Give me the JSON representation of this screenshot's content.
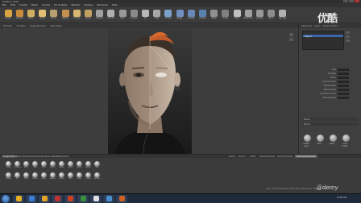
{
  "window": {
    "title": "Mudbox 2014"
  },
  "menu": [
    "File",
    "Edit",
    "Create",
    "Mesh",
    "Curves",
    "UV & Maps",
    "Render",
    "Display",
    "Windows",
    "Help"
  ],
  "toolbar_tools": [
    {
      "label": "Sculpt",
      "color": "#d9a441"
    },
    {
      "label": "Smooth",
      "color": "#c98a3a"
    },
    {
      "label": "Relax",
      "color": "#d0b060"
    },
    {
      "label": "Grab",
      "color": "#e0c070"
    },
    {
      "label": "Pinch",
      "color": "#b8a070"
    },
    {
      "label": "Flatten",
      "color": "#c89050"
    },
    {
      "label": "Foamy",
      "color": "#d8b870"
    },
    {
      "label": "Spray",
      "color": "#c0a060"
    },
    {
      "label": "Repeat",
      "color": "#a0a0a0"
    },
    {
      "label": "Imprint",
      "color": "#b0b0b0"
    },
    {
      "label": "Wax",
      "color": "#9a9a9a"
    },
    {
      "label": "Scrape",
      "color": "#8a8a8a"
    },
    {
      "label": "Fill",
      "color": "#b8b8b8"
    },
    {
      "label": "Knife",
      "color": "#a8a8a8"
    },
    {
      "label": "Smear",
      "color": "#7aa0c8"
    },
    {
      "label": "Bulge",
      "color": "#7090c0"
    },
    {
      "label": "Amplify",
      "color": "#6888b8"
    },
    {
      "label": "Freeze",
      "color": "#5880b0"
    },
    {
      "label": "Mask",
      "color": "#909090"
    },
    {
      "label": "Erase",
      "color": "#808080"
    },
    {
      "label": "Paint",
      "color": "#c0c0c0"
    },
    {
      "label": "Projection",
      "color": "#a0a0a0"
    },
    {
      "label": "Dodge",
      "color": "#989898"
    },
    {
      "label": "Burn",
      "color": "#8c8c8c"
    },
    {
      "label": "Sponge",
      "color": "#b0b0b0"
    }
  ],
  "logo": "优酷",
  "view_tabs": [
    "3D View",
    "UV View",
    "Image Browser",
    "Ptex Setup"
  ],
  "right_panel": {
    "tabs": [
      "Object List",
      "Layers",
      "Viewport Filters"
    ],
    "selected_item": "Layer 1",
    "properties": [
      {
        "label": "Size"
      },
      {
        "label": "Strength"
      },
      {
        "label": "Mirror"
      },
      {
        "label": "Invert Function"
      },
      {
        "label": "Update Plane"
      },
      {
        "label": "Whole Stroke"
      },
      {
        "label": "Orient to Surface"
      },
      {
        "label": "Steady Stroke"
      }
    ],
    "section_stamp": "Stamp",
    "section_stencil": "Stencil",
    "bottom_icons": [
      "Create Layer",
      "Save",
      "Reset",
      "Load Preset"
    ]
  },
  "lower_tabs": [
    "Sculpt Tools",
    "Paint Tools",
    "Curve Tools",
    "Pose Tools",
    "Select/Move Tools"
  ],
  "lower_right_tabs": [
    "Stamp",
    "Stencil",
    "Falloff",
    "Material Presets",
    "Lighting Presets",
    "Camera Bookmarks"
  ],
  "brushes": [
    "Sculpt",
    "Smooth",
    "Relax",
    "Grab",
    "Pinch",
    "Flatten",
    "Foamy",
    "Spray",
    "Repeat",
    "Imprint",
    "Wax",
    "Scrape",
    "Fill",
    "Knife",
    "Smear",
    "Bulge",
    "Amplify",
    "Freeze",
    "Mask",
    "Erase",
    "Sculpt",
    "Smooth"
  ],
  "status": "Total: 2,067,712   Selected: 0   GPU Mem: 1026   Active: 0   Highest: 0   FPS: 32.74",
  "taskbar": {
    "apps": [
      {
        "color": "#e8b020"
      },
      {
        "color": "#3a7bd5"
      },
      {
        "color": "#e8a020"
      },
      {
        "color": "#c03030"
      },
      {
        "color": "#d04020"
      },
      {
        "color": "#3a8f3a"
      },
      {
        "color": "#e0e0e0"
      },
      {
        "color": "#4a90d0"
      },
      {
        "color": "#d06020"
      }
    ],
    "time": "11:35 AM"
  },
  "watermark": "@demy"
}
